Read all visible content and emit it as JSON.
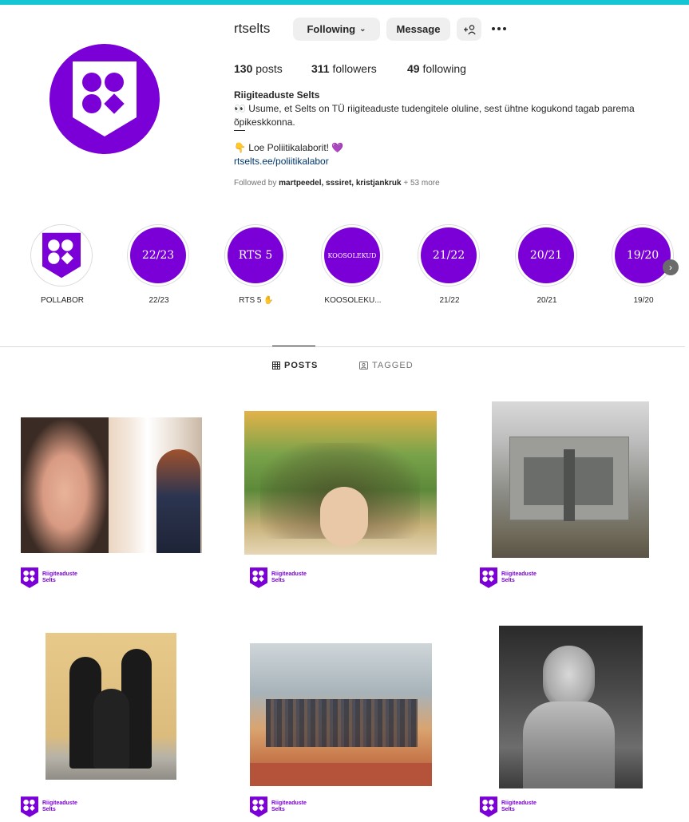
{
  "colors": {
    "brand": "#7b00d8",
    "topbar": "#16c5d3"
  },
  "profile": {
    "username": "rtselts",
    "following_btn": "Following",
    "message_btn": "Message",
    "add_user_icon": "+R",
    "posts_count": "130",
    "posts_label": "posts",
    "followers_count": "311",
    "followers_label": "followers",
    "following_count": "49",
    "following_label": "following",
    "full_name": "Riigiteaduste Selts",
    "bio_line1": "👀 Usume, et Selts on TÜ riigiteaduste tudengitele oluline, sest ühtne kogukond tagab parema õpikeskkonna.",
    "bio_line2": "👇 Loe Poliitikalaborit! 💜",
    "bio_link": "rtselts.ee/poliitikalabor",
    "followed_by_prefix": "Followed by",
    "followed_by_names": "martpeedel, sssiret, kristjankruk",
    "followed_by_more": "+ 53 more"
  },
  "highlights": [
    {
      "inner": "",
      "label": "POLLABOR"
    },
    {
      "inner": "22/23",
      "label": "22/23"
    },
    {
      "inner": "RTS 5",
      "label": "RTS 5 ✋"
    },
    {
      "inner": "KOOSOLEKUD",
      "label": "KOOSOLEKU..."
    },
    {
      "inner": "21/22",
      "label": "21/22"
    },
    {
      "inner": "20/21",
      "label": "20/21"
    },
    {
      "inner": "19/20",
      "label": "19/20"
    }
  ],
  "tabs": {
    "posts": "POSTS",
    "tagged": "TAGGED"
  },
  "posts": [
    {
      "brand_line1": "Riigiteaduste",
      "brand_line2": "Selts"
    },
    {
      "brand_line1": "Riigiteaduste",
      "brand_line2": "Selts"
    },
    {
      "brand_line1": "Riigiteaduste",
      "brand_line2": "Selts"
    },
    {
      "brand_line1": "Riigiteaduste",
      "brand_line2": "Selts"
    },
    {
      "brand_line1": "Riigiteaduste",
      "brand_line2": "Selts"
    },
    {
      "brand_line1": "Riigiteaduste",
      "brand_line2": "Selts"
    }
  ]
}
